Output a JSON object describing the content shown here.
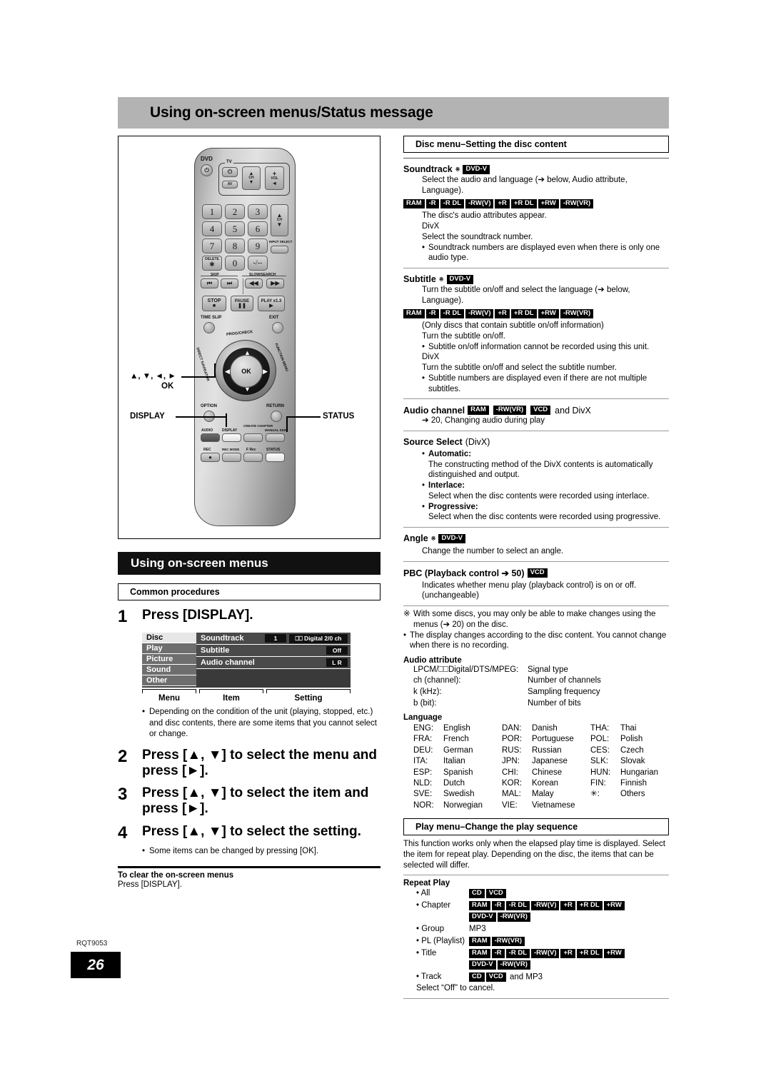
{
  "header": {
    "title": "Using on-screen menus/Status message"
  },
  "remote": {
    "dvd_label": "DVD",
    "tv_label": "TV",
    "av_label": "AV",
    "ch_label": "CH",
    "vol_label": "VOL",
    "vol_plus": "+",
    "input_select": "INPUT SELECT",
    "numbers": [
      "1",
      "2",
      "3",
      "4",
      "5",
      "6",
      "7",
      "8",
      "9"
    ],
    "delete_label": "DELETE",
    "delete_star": "∗",
    "zero": "0",
    "dash": "-/--",
    "skip_label": "SKIP",
    "slowsearch_label": "SLOW/SEARCH",
    "stop": "STOP",
    "pause": "PAUSE",
    "play": "PLAY x1.3",
    "time_slip": "TIME SLIP",
    "exit": "EXIT",
    "prog_check": "PROG/CHECK",
    "direct_nav": "DIRECT NAVIGATOR",
    "function_menu": "FUNCTION MENU",
    "ok": "OK",
    "option": "OPTION",
    "return": "RETURN",
    "audio": "AUDIO",
    "display": "DISPLAY",
    "create_chapter": "CREATE CHAPTER",
    "manual_skip": "MANUAL SKIP",
    "rec": "REC",
    "rec_mode": "REC MODE",
    "f_rec": "F Rec",
    "status": "STATUS",
    "callout_cursor": "▲, ▼, ◄, ►",
    "callout_ok": "OK",
    "callout_display": "DISPLAY",
    "callout_status": "STATUS"
  },
  "left": {
    "section_title": "Using on-screen menus",
    "common_procedures": "Common procedures",
    "step1": {
      "num": "1",
      "text": "Press [DISPLAY]."
    },
    "osd": {
      "menus": [
        "Disc",
        "Play",
        "Picture",
        "Sound",
        "Other"
      ],
      "rows": [
        {
          "item": "Soundtrack",
          "values": [
            "1",
            "⎕⎕ Digital  2/0 ch"
          ]
        },
        {
          "item": "Subtitle",
          "values": [
            "Off"
          ]
        },
        {
          "item": "Audio channel",
          "values": [
            "L R"
          ]
        }
      ],
      "bracket_labels": [
        "Menu",
        "Item",
        "Setting"
      ]
    },
    "note1": "Depending on the condition of the unit (playing, stopped, etc.) and disc contents, there are some items that you cannot select or change.",
    "step2": {
      "num": "2",
      "text": "Press [▲, ▼] to select the menu and press [►]."
    },
    "step3": {
      "num": "3",
      "text": "Press [▲, ▼] to select the item and press [►]."
    },
    "step4": {
      "num": "4",
      "text": "Press [▲, ▼] to select the setting."
    },
    "note2": "Some items can be changed by pressing [OK].",
    "clear_heading": "To clear the on-screen menus",
    "clear_text": "Press [DISPLAY]."
  },
  "right": {
    "disc_menu_title": "Disc menu–Setting the disc content",
    "soundtrack": {
      "heading": "Soundtrack",
      "asterisk": "※",
      "badge": "DVD-V",
      "line1": "Select the audio and language (➔ below, Audio attribute, Language).",
      "chips": [
        "RAM",
        "-R",
        "-R DL",
        "-RW(V)",
        "+R",
        "+R DL",
        "+RW",
        "-RW(VR)"
      ],
      "line2": "The disc's audio attributes appear.",
      "line3": "DivX",
      "line4": "Select the soundtrack number.",
      "bullet": "Soundtrack numbers are displayed even when there is only one audio type."
    },
    "subtitle": {
      "heading": "Subtitle",
      "asterisk": "※",
      "badge": "DVD-V",
      "line1": "Turn the subtitle on/off and select the language (➔ below, Language).",
      "chips": [
        "RAM",
        "-R",
        "-R DL",
        "-RW(V)",
        "+R",
        "+R DL",
        "+RW",
        "-RW(VR)"
      ],
      "line2": "(Only discs that contain subtitle on/off information)",
      "line3": "Turn the subtitle on/off.",
      "bullet1": "Subtitle on/off information cannot be recorded using this unit.",
      "line4": "DivX",
      "line5": "Turn the subtitle on/off and select the subtitle number.",
      "bullet2": "Subtitle numbers are displayed even if there are not multiple subtitles."
    },
    "audio_channel": {
      "heading": "Audio channel",
      "chips": [
        "RAM",
        "-RW(VR)",
        "VCD"
      ],
      "suffix": "and DivX",
      "ref": "➔ 20, Changing audio during play"
    },
    "source_select": {
      "heading": "Source Select",
      "suffix": "(DivX)",
      "items": [
        {
          "label": "Automatic:",
          "text": "The constructing method of the DivX contents is automatically distinguished and output."
        },
        {
          "label": "Interlace:",
          "text": "Select when the disc contents were recorded using interlace."
        },
        {
          "label": "Progressive:",
          "text": "Select when the disc contents were recorded using progressive."
        }
      ]
    },
    "angle": {
      "heading": "Angle",
      "asterisk": "※",
      "badge": "DVD-V",
      "text": "Change the number to select an angle."
    },
    "pbc": {
      "heading": "PBC (Playback control ➔ 50)",
      "badge": "VCD",
      "text": "Indicates whether menu play (playback control) is on or off. (unchangeable)"
    },
    "footnote_mark": "※",
    "footnote": "With some discs, you may only be able to make changes using the menus (➔ 20) on the disc.",
    "footnote_bullet": "The display changes according to the disc content. You cannot change when there is no recording.",
    "audio_attribute": {
      "heading": "Audio attribute",
      "rows": [
        {
          "key": "LPCM/⎕⎕Digital/DTS/MPEG:",
          "val": "Signal type"
        },
        {
          "key": "ch (channel):",
          "val": "Number of channels"
        },
        {
          "key": "k (kHz):",
          "val": "Sampling frequency"
        },
        {
          "key": "b (bit):",
          "val": "Number of bits"
        }
      ]
    },
    "language": {
      "heading": "Language",
      "col1": [
        {
          "code": "ENG:",
          "name": "English"
        },
        {
          "code": "FRA:",
          "name": "French"
        },
        {
          "code": "DEU:",
          "name": "German"
        },
        {
          "code": "ITA:",
          "name": "Italian"
        },
        {
          "code": "ESP:",
          "name": "Spanish"
        },
        {
          "code": "NLD:",
          "name": "Dutch"
        },
        {
          "code": "SVE:",
          "name": "Swedish"
        },
        {
          "code": "NOR:",
          "name": "Norwegian"
        }
      ],
      "col2": [
        {
          "code": "DAN:",
          "name": "Danish"
        },
        {
          "code": "POR:",
          "name": "Portuguese"
        },
        {
          "code": "RUS:",
          "name": "Russian"
        },
        {
          "code": "JPN:",
          "name": "Japanese"
        },
        {
          "code": "CHI:",
          "name": "Chinese"
        },
        {
          "code": "KOR:",
          "name": "Korean"
        },
        {
          "code": "MAL:",
          "name": "Malay"
        },
        {
          "code": "VIE:",
          "name": "Vietnamese"
        }
      ],
      "col3": [
        {
          "code": "THA:",
          "name": "Thai"
        },
        {
          "code": "POL:",
          "name": "Polish"
        },
        {
          "code": "CES:",
          "name": "Czech"
        },
        {
          "code": "SLK:",
          "name": "Slovak"
        },
        {
          "code": "HUN:",
          "name": "Hungarian"
        },
        {
          "code": "FIN:",
          "name": "Finnish"
        },
        {
          "code": "✳:",
          "name": "Others"
        }
      ]
    },
    "play_menu": {
      "title": "Play menu–Change the play sequence",
      "intro": "This function works only when the elapsed play time is displayed. Select the item for repeat play. Depending on the disc, the items that can be selected will differ.",
      "repeat_heading": "Repeat Play",
      "rows": [
        {
          "label": "• All",
          "chips": [
            "CD",
            "VCD"
          ],
          "chips2": [],
          "suffix": ""
        },
        {
          "label": "• Chapter",
          "chips": [
            "RAM",
            "-R",
            "-R DL",
            "-RW(V)",
            "+R",
            "+R DL",
            "+RW"
          ],
          "chips2": [
            "DVD-V",
            "-RW(VR)"
          ],
          "suffix": ""
        },
        {
          "label": "• Group",
          "chips": [],
          "chips2": [],
          "suffix": "MP3"
        },
        {
          "label": "• PL (Playlist)",
          "chips": [
            "RAM",
            "-RW(VR)"
          ],
          "chips2": [],
          "suffix": ""
        },
        {
          "label": "• Title",
          "chips": [
            "RAM",
            "-R",
            "-R DL",
            "-RW(V)",
            "+R",
            "+R DL",
            "+RW"
          ],
          "chips2": [
            "DVD-V",
            "-RW(VR)"
          ],
          "suffix": ""
        },
        {
          "label": "• Track",
          "chips": [
            "CD",
            "VCD"
          ],
          "chips2": [],
          "suffix": "and MP3"
        }
      ],
      "cancel_note": "Select “Off” to cancel."
    }
  },
  "footer": {
    "code": "RQT9053",
    "page": "26"
  }
}
